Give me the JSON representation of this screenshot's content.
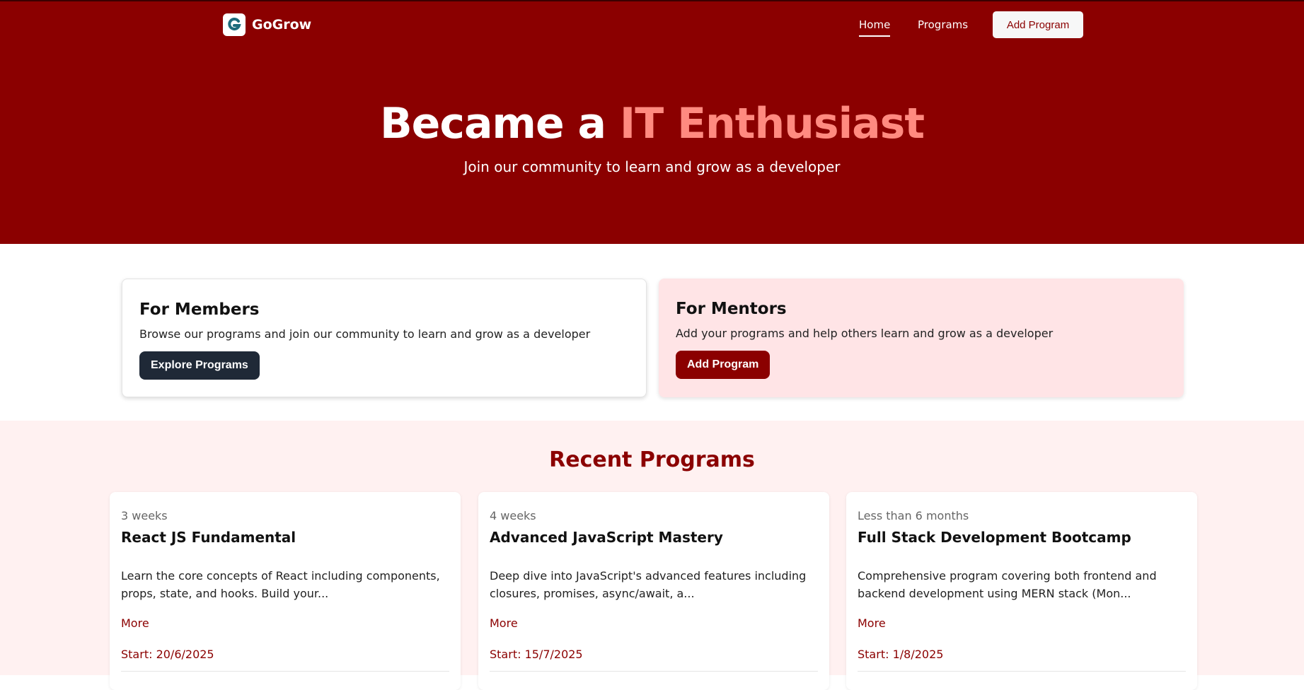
{
  "nav": {
    "brand": "GoGrow",
    "logo_letter": "G",
    "links": [
      "Home",
      "Programs"
    ],
    "add_button": "Add Program"
  },
  "hero": {
    "title_prefix": "Became a",
    "title_accent": "IT Enthusiast",
    "subtitle": "Join our community to learn and grow as a developer"
  },
  "members": {
    "title": "For Members",
    "description": "Browse our programs and join our community to learn and grow as a developer",
    "button": "Explore Programs"
  },
  "mentors": {
    "title": "For Mentors",
    "description": "Add your programs and help others learn and grow as a developer",
    "button": "Add Program"
  },
  "recent": {
    "title": "Recent Programs",
    "programs": [
      {
        "duration": "3 weeks",
        "title": "React JS Fundamental",
        "description": "Learn the core concepts of React including components, props, state, and hooks. Build your...",
        "more": "More",
        "start": "Start: 20/6/2025"
      },
      {
        "duration": "4 weeks",
        "title": "Advanced JavaScript Mastery",
        "description": "Deep dive into JavaScript's advanced features including closures, promises, async/await, a...",
        "more": "More",
        "start": "Start: 15/7/2025"
      },
      {
        "duration": "Less than 6 months",
        "title": "Full Stack Development Bootcamp",
        "description": "Comprehensive program covering both frontend and backend development using MERN stack (Mon...",
        "more": "More",
        "start": "Start: 1/8/2025"
      }
    ]
  },
  "colors": {
    "primary": "#8b0000",
    "accent": "#ff8a80",
    "dark_button": "#1f2937",
    "mentor_card": "#ffe4e6",
    "recent_bg": "#fff1f1"
  }
}
